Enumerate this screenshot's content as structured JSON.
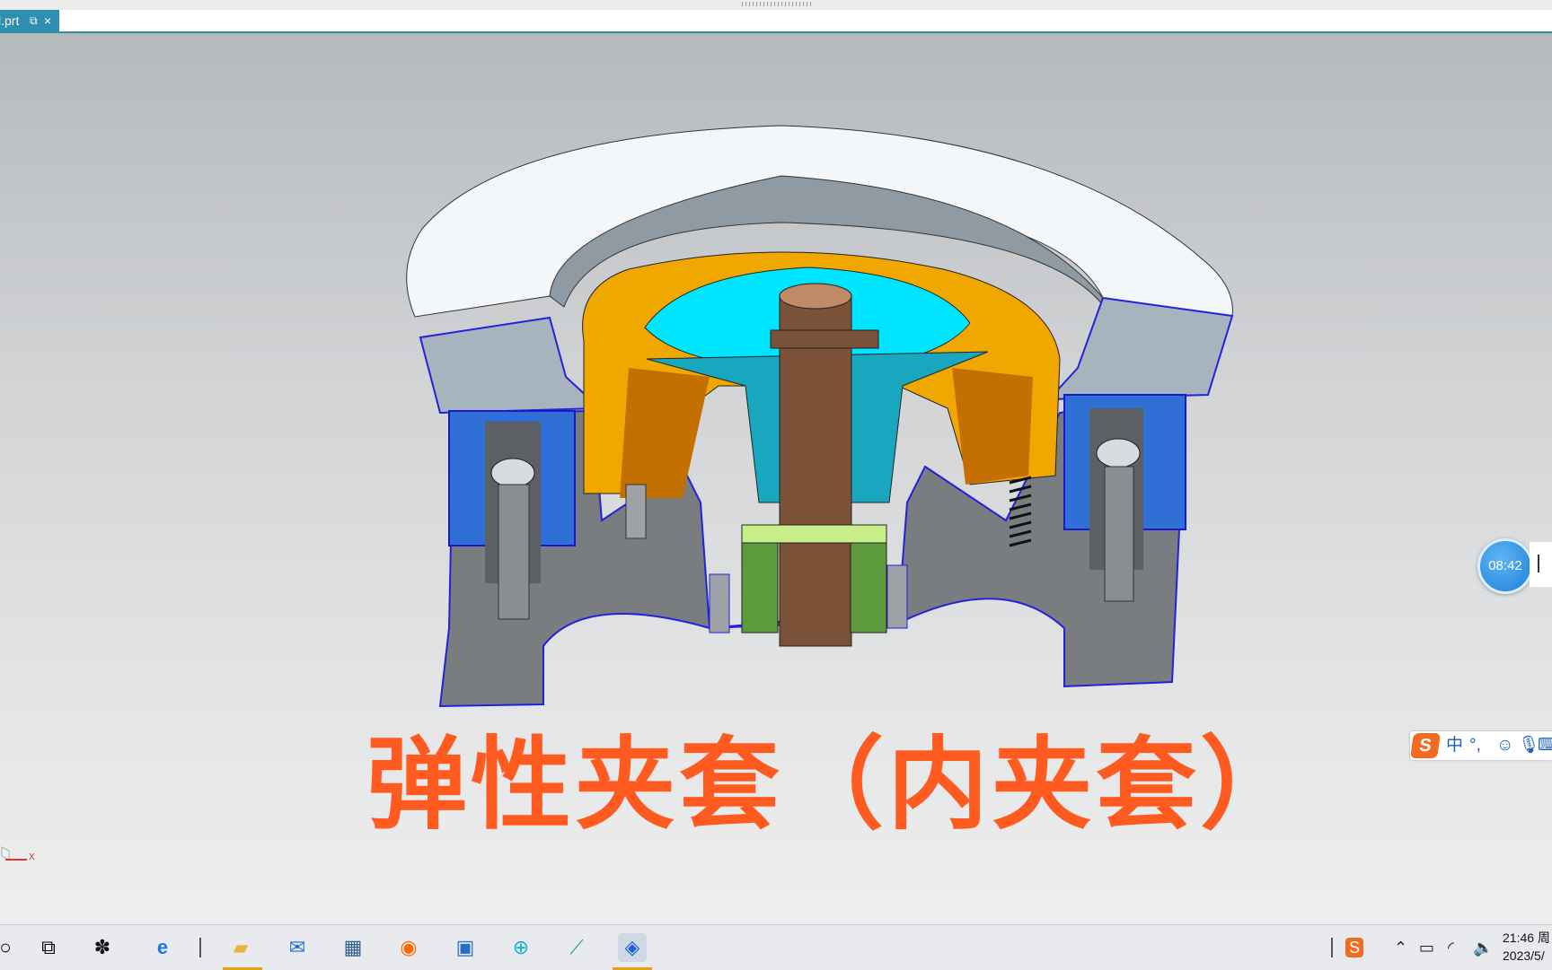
{
  "window": {
    "tab_label": "l.prt",
    "tab_close": "×",
    "tab_pin_icon": "pin-icon"
  },
  "caption": "弹性夹套（内夹套）",
  "timer": {
    "time": "08:42"
  },
  "ime": {
    "logo": "S",
    "mode": "中",
    "punct": "°,",
    "icons": [
      "smiley-icon",
      "microphone-icon",
      "keyboard-icon"
    ]
  },
  "axis": {
    "label": "X"
  },
  "taskbar": {
    "apps": [
      "search",
      "task-view",
      "fan-app",
      "internet-explorer",
      "file-explorer",
      "mail",
      "calculator",
      "firefox",
      "remote-desktop",
      "plus-app",
      "chart-app",
      "nx-cad"
    ],
    "tray": {
      "ime_icon": "S",
      "clock_time": "21:46 周",
      "clock_date": "2023/5/"
    }
  }
}
